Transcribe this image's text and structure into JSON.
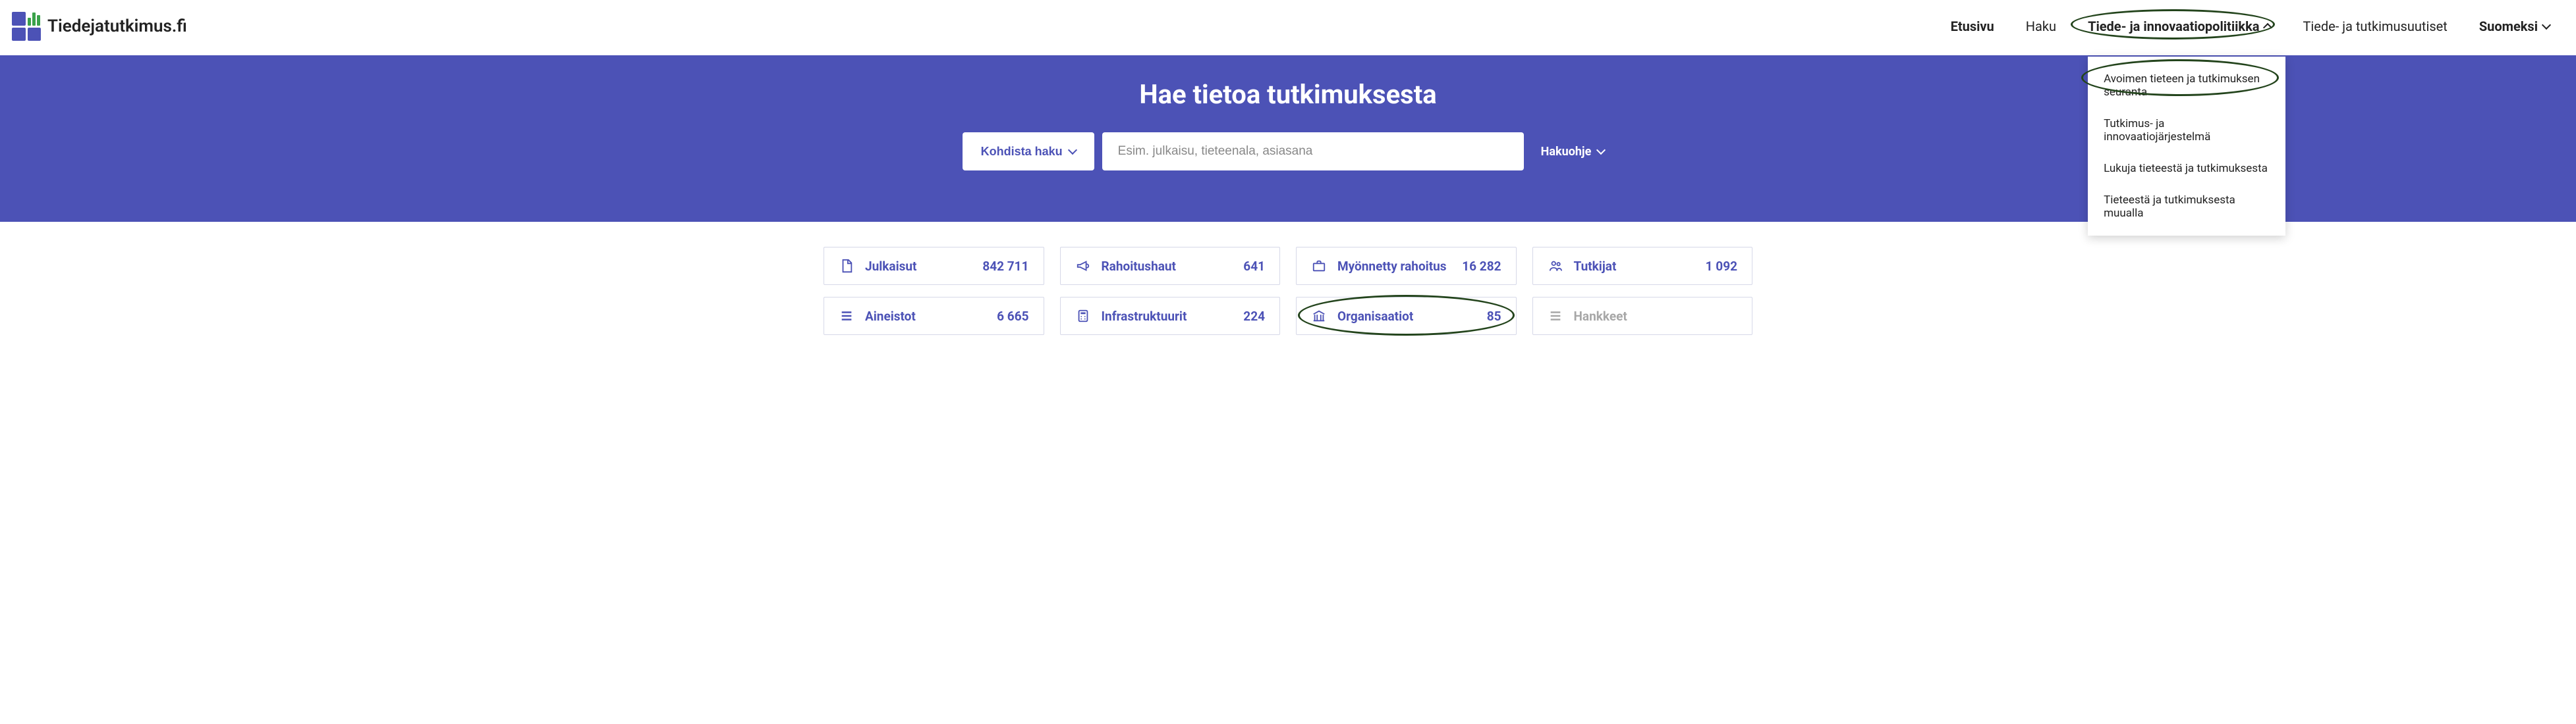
{
  "brand": {
    "name": "Tiedejatutkimus.fi"
  },
  "nav": {
    "home": "Etusivu",
    "search": "Haku",
    "policy": "Tiede- ja innovaatiopolitiikka",
    "news": "Tiede- ja tutkimusuutiset",
    "language": "Suomeksi"
  },
  "policy_menu": {
    "item0": "Avoimen tieteen ja tutkimuksen seuranta",
    "item1": "Tutkimus- ja innovaatiojärjestelmä",
    "item2": "Lukuja tieteestä ja tutkimuksesta",
    "item3": "Tieteestä ja tutkimuksesta muualla"
  },
  "hero": {
    "title": "Hae tietoa tutkimuksesta",
    "focus_button": "Kohdista haku",
    "placeholder": "Esim. julkaisu, tieteenala, asiasana",
    "guide": "Hakuohje"
  },
  "stats": {
    "publications": {
      "label": "Julkaisut",
      "count": "842 711"
    },
    "funding_calls": {
      "label": "Rahoitushaut",
      "count": "641"
    },
    "granted_funding": {
      "label": "Myönnetty rahoitus",
      "count": "16 282"
    },
    "researchers": {
      "label": "Tutkijat",
      "count": "1 092"
    },
    "datasets": {
      "label": "Aineistot",
      "count": "6 665"
    },
    "infrastructures": {
      "label": "Infrastruktuurit",
      "count": "224"
    },
    "organisations": {
      "label": "Organisaatiot",
      "count": "85"
    },
    "projects": {
      "label": "Hankkeet",
      "count": ""
    }
  },
  "colors": {
    "primary": "#4c52b6",
    "annotation": "#23441c"
  }
}
